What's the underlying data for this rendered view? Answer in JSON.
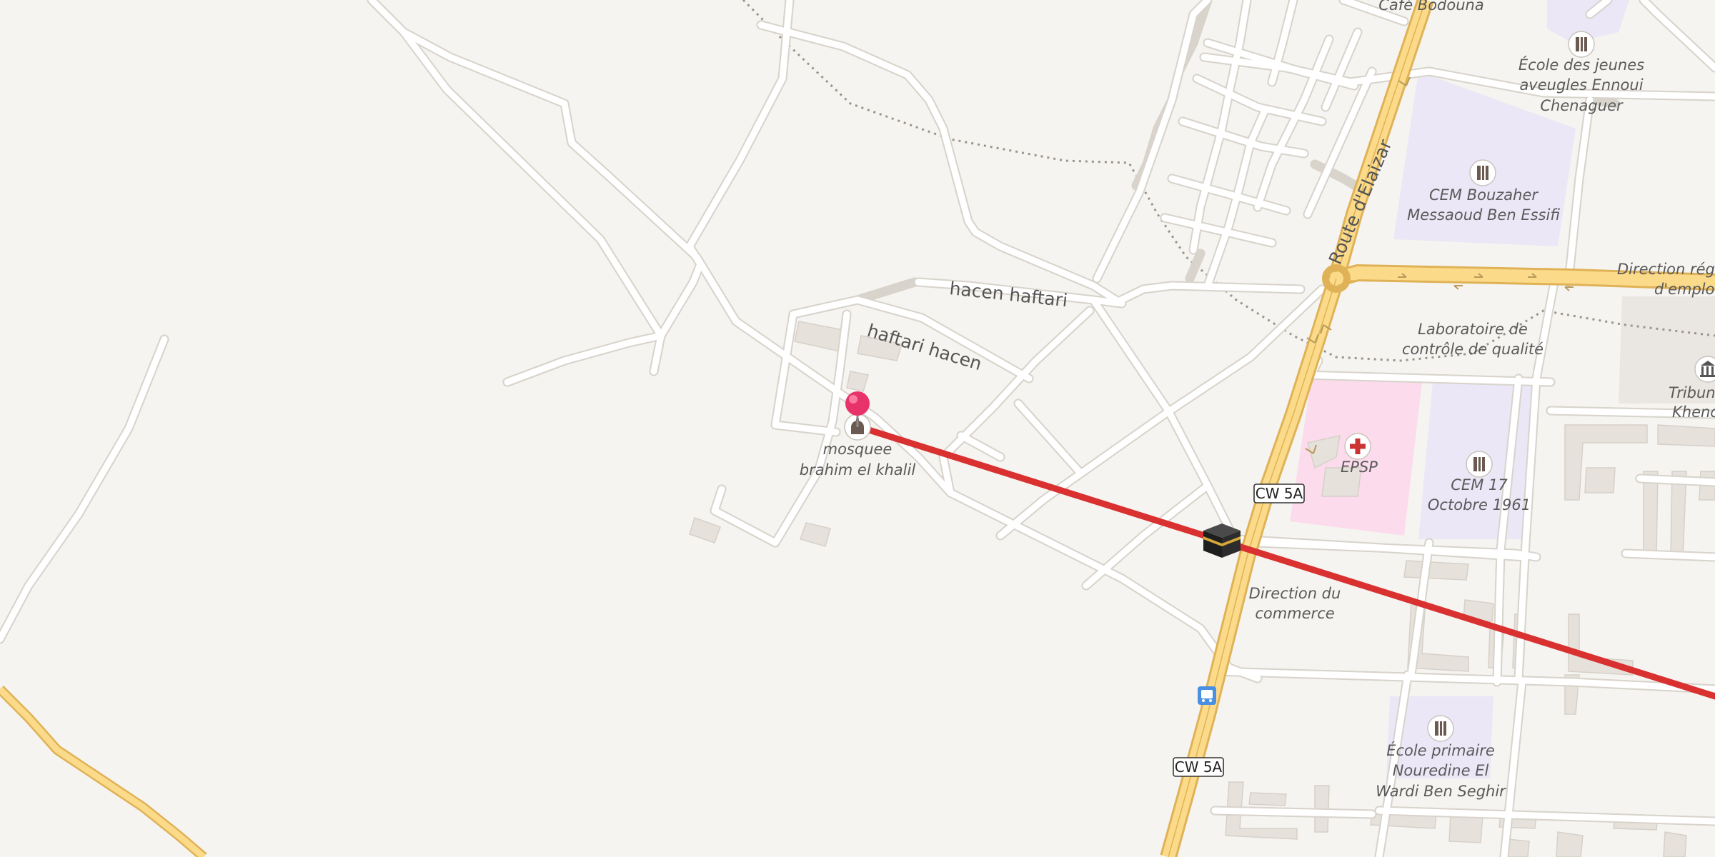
{
  "map": {
    "labels": {
      "cafe": "Café Bodouna",
      "ecole_aveugles": [
        "École des jeunes",
        "aveugles Ennoui",
        "Chenaguer"
      ],
      "cem_bouzaher": [
        "CEM Bouzaher",
        "Messaoud Ben Essifi"
      ],
      "direction_regionale": [
        "Direction régi",
        "d'emploi"
      ],
      "laboratoire": [
        "Laboratoire de",
        "contrôle de qualité"
      ],
      "tribunal": [
        "Tribun",
        "Khenc"
      ],
      "epsp": "EPSP",
      "cem_17": [
        "CEM 17",
        "Octobre 1961"
      ],
      "direction_commerce": [
        "Direction du",
        "commerce"
      ],
      "ecole_primaire": [
        "École primaire",
        "Nouredine El",
        "Wardi Ben Seghir"
      ],
      "mosque": [
        "mosquee",
        "brahim el khalil"
      ]
    },
    "streets": {
      "hacen_haftari": "hacen haftari",
      "haftari_hacen": "haftari hacen",
      "route_elaizar": "Route d'Elaizar"
    },
    "shields": [
      "CW 5A",
      "CW 5A"
    ],
    "icons": {
      "pin": "location-pin-icon",
      "kaaba": "kaaba-icon",
      "bus": "bus-stop-icon",
      "mosque": "mosque-icon",
      "school": "school-icon",
      "hospital": "hospital-cross-icon",
      "courthouse": "courthouse-icon"
    },
    "colors": {
      "background": "#f6f4f0",
      "school_area": "#ebe7f7",
      "hospital_area": "#fcdcec",
      "main_road": "#fbdb8a",
      "qibla_line": "#d93030",
      "pin": "#e8336a"
    }
  }
}
